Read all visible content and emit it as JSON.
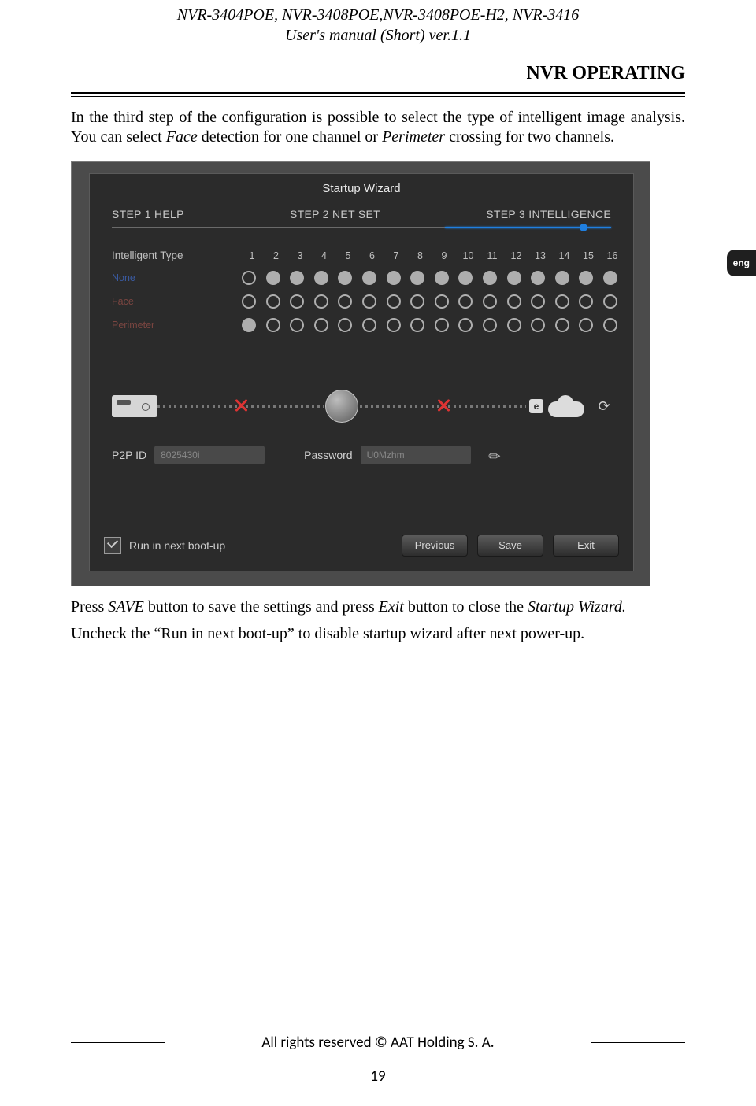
{
  "header": {
    "models": "NVR-3404POE, NVR-3408POE,NVR-3408POE-H2, NVR-3416",
    "manual_line": "User's manual (Short) ver.1.1"
  },
  "section_title": "NVR OPERATING",
  "intro_html": "In the third step of the configuration is possible to select the type of intelligent image analysis. You can select Face detection for one channel or Perimeter crossing for two channels.",
  "lang_tab": "eng",
  "wizard": {
    "title": "Startup Wizard",
    "steps": [
      "STEP 1 HELP",
      "STEP 2 NET SET",
      "STEP 3 INTELLIGENCE"
    ],
    "type_label": "Intelligent Type",
    "channels": [
      "1",
      "2",
      "3",
      "4",
      "5",
      "6",
      "7",
      "8",
      "9",
      "10",
      "11",
      "12",
      "13",
      "14",
      "15",
      "16"
    ],
    "rows": {
      "none": "None",
      "face": "Face",
      "perimeter": "Perimeter"
    },
    "p2p_label": "P2P ID",
    "p2p_value": "8025430i",
    "password_label": "Password",
    "password_value": "U0Mzhm",
    "e_badge": "e",
    "run_label": "Run in next boot-up",
    "buttons": {
      "previous": "Previous",
      "save": "Save",
      "exit": "Exit"
    }
  },
  "after1": "Press SAVE button to save the settings and press Exit button to close the Startup Wizard.",
  "after2": "Uncheck the “Run in next boot-up” to disable startup wizard after next power-up.",
  "footer": {
    "copyright": "All rights reserved © AAT Holding S. A.",
    "page": "19"
  }
}
